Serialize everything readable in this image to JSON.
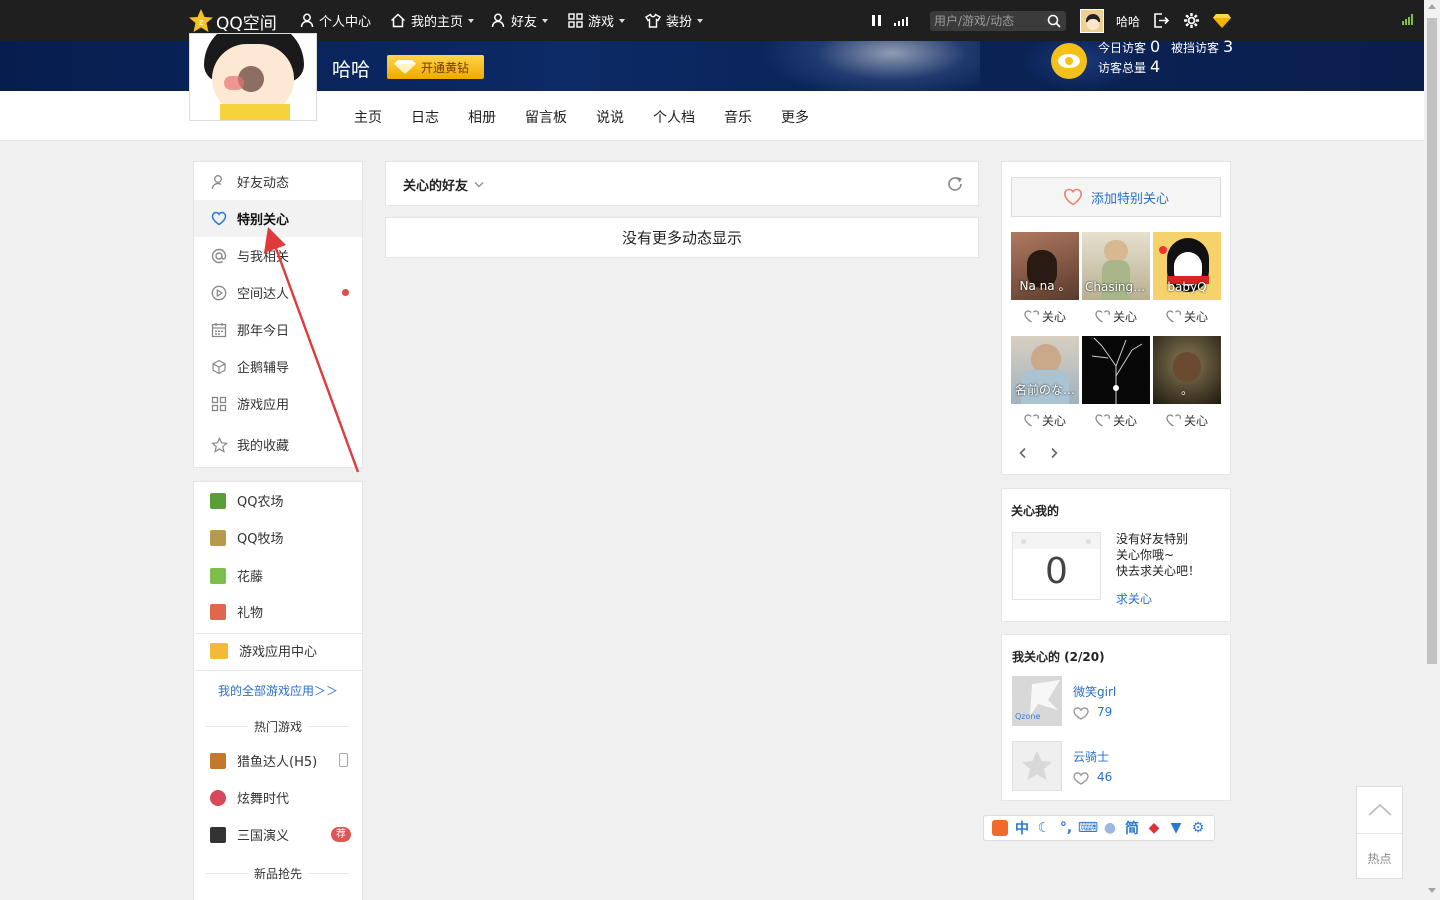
{
  "topbar": {
    "logo_text": "QQ空间",
    "nav": [
      {
        "label": "个人中心",
        "icon": "user-icon"
      },
      {
        "label": "我的主页",
        "icon": "home-icon"
      },
      {
        "label": "好友",
        "icon": "friends-icon"
      },
      {
        "label": "游戏",
        "icon": "grid-icon"
      },
      {
        "label": "装扮",
        "icon": "shirt-icon"
      }
    ],
    "search_placeholder": "用户/游戏/动态",
    "user_name": "哈哈"
  },
  "profile": {
    "name": "哈哈",
    "vip_button": "开通黄钻",
    "today_visitors_label": "今日访客",
    "today_visitors": "0",
    "blocked_visitors_label": "被挡访客",
    "blocked_visitors": "3",
    "total_visitors_label": "访客总量",
    "total_visitors": "4"
  },
  "tabs": [
    "主页",
    "日志",
    "相册",
    "留言板",
    "说说",
    "个人档",
    "音乐",
    "更多"
  ],
  "left_menu": {
    "items": [
      {
        "label": "好友动态",
        "icon": "user-icon"
      },
      {
        "label": "特别关心",
        "icon": "heart-icon",
        "active": true
      },
      {
        "label": "与我相关",
        "icon": "at-icon"
      },
      {
        "label": "空间达人",
        "icon": "play-circle-icon"
      },
      {
        "label": "那年今日",
        "icon": "calendar-icon"
      },
      {
        "label": "企鹅辅导",
        "icon": "cube-icon"
      },
      {
        "label": "游戏应用",
        "icon": "apps-icon"
      },
      {
        "label": "我的收藏",
        "icon": "star-icon"
      }
    ],
    "apps": [
      {
        "label": "QQ农场",
        "color": "#5a9e3a"
      },
      {
        "label": "QQ牧场",
        "color": "#b49a4a"
      },
      {
        "label": "花藤",
        "color": "#7cc04a"
      },
      {
        "label": "礼物",
        "color": "#e0684a"
      }
    ],
    "game_center": "游戏应用中心",
    "all_games_link": "我的全部游戏应用＞＞",
    "hot_games_title": "热门游戏",
    "hot_games": [
      {
        "label": "猎鱼达人(H5)",
        "color": "#c07a2a"
      },
      {
        "label": "炫舞时代",
        "color": "#d9485a"
      },
      {
        "label": "三国演义",
        "color": "#333",
        "badge": "荐"
      }
    ],
    "new_games_title": "新品抢先"
  },
  "feed": {
    "filter_label": "关心的好友",
    "empty_text": "没有更多动态显示"
  },
  "special_care": {
    "add_button": "添加特别关心",
    "care_label": "关心",
    "friends": [
      {
        "name": "Na na 。",
        "bg": "#8a5a46"
      },
      {
        "name": "Chasing …",
        "bg": "#c9c2a8"
      },
      {
        "name": "babyQ",
        "bg": "#f2d26a"
      },
      {
        "name": "名前のな…",
        "bg": "#a8b8c4"
      },
      {
        "name": "",
        "bg": "#0a0a0a"
      },
      {
        "name": "。",
        "bg": "#3a3320"
      }
    ]
  },
  "care_me": {
    "title": "关心我的",
    "count": "0",
    "text1": "没有好友特别",
    "text2": "关心你哦~",
    "text3": "快去求关心吧！",
    "link": "求关心"
  },
  "my_care": {
    "title": "我关心的 (2/20)",
    "items": [
      {
        "name": "微笑girl",
        "count": "79"
      },
      {
        "name": "云骑士",
        "count": "46"
      }
    ]
  },
  "back_top": {
    "label": "热点"
  },
  "ime": {
    "items": [
      "中",
      "简"
    ]
  }
}
